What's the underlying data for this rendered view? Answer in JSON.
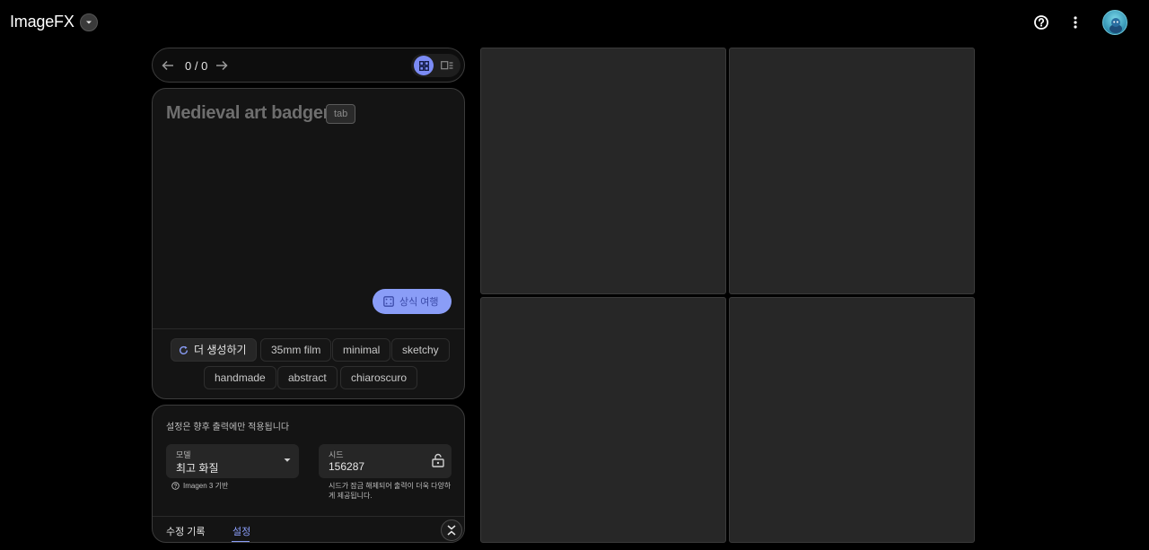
{
  "header": {
    "app_title": "ImageFX",
    "title_menu_icon": "chevron-down-icon",
    "help_icon": "help-circle-icon",
    "more_icon": "more-vert-icon",
    "avatar_icon": "user-avatar"
  },
  "navigator": {
    "counter": "0 / 0",
    "prev_icon": "arrow-left-icon",
    "next_icon": "arrow-right-icon",
    "views": [
      "grid-view-icon",
      "list-view-icon"
    ],
    "active_view": "grid-view-icon",
    "accent": "#7b8bf5"
  },
  "prompt": {
    "text": "Medieval art badger",
    "tab_hint": "tab",
    "lucky_label": "상식 여행",
    "lucky_icon": "dice-icon",
    "regen_label": "더 생성하기",
    "regen_icon": "refresh-icon",
    "chips": [
      "35mm film",
      "minimal",
      "sketchy",
      "handmade",
      "abstract",
      "chiaroscuro"
    ]
  },
  "settings": {
    "note": "설정은 향후 출력에만 적용됩니다",
    "model": {
      "label": "모델",
      "value": "최고 화질",
      "hint": "Imagen 3 기반",
      "hint_icon": "help-circle-icon"
    },
    "seed": {
      "label": "시드",
      "value": "156287",
      "lock_icon": "lock-open-icon",
      "hint": "시드가 잠금 해제되어 출력이 더욱 다양하게 제공됩니다."
    },
    "tabs": [
      "수정 기록",
      "설정"
    ],
    "active_tab": "설정",
    "collapse_icon": "collapse-icon"
  },
  "images": {
    "tile_color": "#272727",
    "count": 4
  }
}
